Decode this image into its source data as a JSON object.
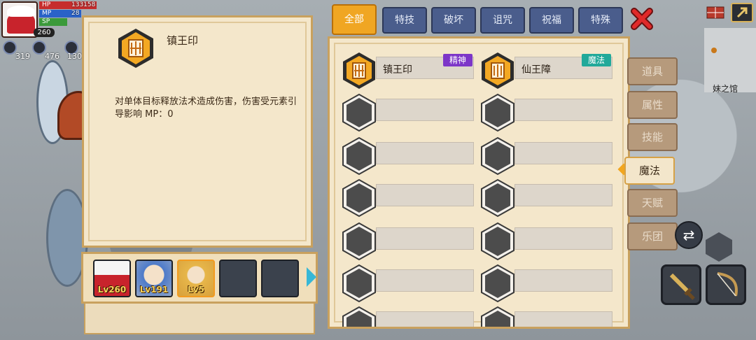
{
  "hud": {
    "hp_label": "HP",
    "hp_value": "133158",
    "mp_label": "MP",
    "mp_value": "28",
    "sp_label": "SP",
    "level": "260",
    "stats": [
      "319",
      "476",
      "130"
    ]
  },
  "minimap": {
    "label": "妹之馆"
  },
  "detail": {
    "title": "镇王印",
    "description": "对单体目标释放法术造成伤害，伤害受元素引导影响  MP：0"
  },
  "party": [
    {
      "level": "Lv260",
      "color": "#c8232c"
    },
    {
      "level": "Lv191",
      "color": "#4d7ac9"
    },
    {
      "level": "Lv5",
      "color": "#e7b64a"
    },
    {
      "level": ""
    },
    {
      "level": ""
    }
  ],
  "tabs": [
    "全部",
    "特技",
    "破坏",
    "诅咒",
    "祝福",
    "特殊"
  ],
  "side_buttons": [
    "道具",
    "属性",
    "技能",
    "魔法",
    "天赋",
    "乐团"
  ],
  "skills": [
    {
      "name": "镇王印",
      "tag": "精神",
      "tag_color": "purple",
      "active": true
    },
    {
      "name": "仙王障",
      "tag": "魔法",
      "tag_color": "teal",
      "active": true
    }
  ],
  "colors": {
    "accent": "#f0a623",
    "panel": "#f4e7cb",
    "tab": "#4a5d8c",
    "close": "#e02a2a"
  }
}
